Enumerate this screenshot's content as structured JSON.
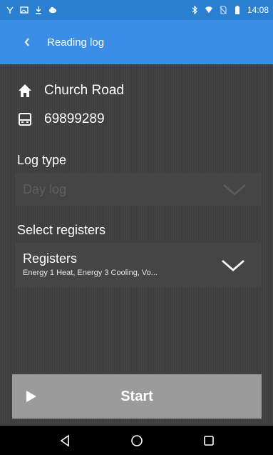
{
  "status_bar": {
    "time": "14:08",
    "left_icons": [
      "usb-debug-icon",
      "gallery-notification-icon",
      "download-icon",
      "cloud-sync-icon"
    ],
    "right_icons": [
      "bluetooth-icon",
      "wifi-icon",
      "no-sim-icon",
      "battery-icon"
    ]
  },
  "app_bar": {
    "title": "Reading log",
    "background": "#3b8ee5"
  },
  "site": {
    "address": "Church Road",
    "meter_id": "69899289"
  },
  "log_type": {
    "label": "Log type",
    "value": "Day log",
    "disabled": true
  },
  "registers": {
    "label": "Select registers",
    "title": "Registers",
    "summary": "Energy 1 Heat, Energy 3 Cooling, Vo..."
  },
  "start_button": {
    "label": "Start"
  },
  "nav_bar": {
    "buttons": [
      "back-icon",
      "home-icon",
      "recents-icon"
    ]
  }
}
